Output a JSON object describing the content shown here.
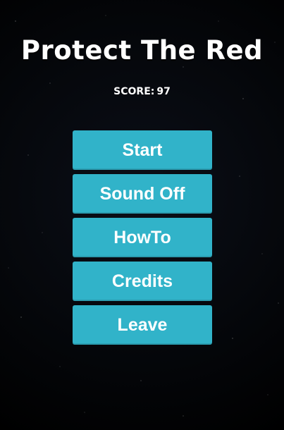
{
  "game": {
    "title": "Protect The Red",
    "score_label": "SCORE:",
    "score_value": "97"
  },
  "menu": {
    "buttons": [
      {
        "label": "Start"
      },
      {
        "label": "Sound Off"
      },
      {
        "label": "HowTo"
      },
      {
        "label": "Credits"
      },
      {
        "label": "Leave"
      }
    ]
  },
  "colors": {
    "background": "#000000",
    "button": "#31b3c9",
    "text": "#ffffff"
  }
}
